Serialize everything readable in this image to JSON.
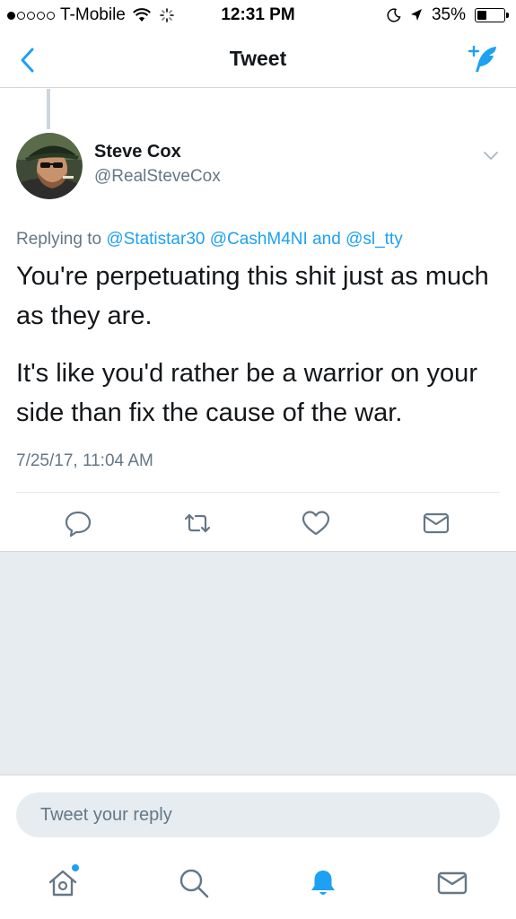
{
  "status_bar": {
    "carrier": "T-Mobile",
    "signal_bars_filled": 1,
    "signal_bars_total": 5,
    "time": "12:31 PM",
    "battery_percent": "35%",
    "battery_level": 0.35
  },
  "nav": {
    "title": "Tweet",
    "back_icon": "chevron-left-icon",
    "compose_icon": "compose-feather-icon"
  },
  "tweet": {
    "author_name": "Steve Cox",
    "author_handle": "@RealSteveCox",
    "replying_prefix": "Replying to",
    "mentions": [
      "@Statistar30",
      "@CashM4NI",
      "@sl_tty"
    ],
    "mention_joiner": "and",
    "paragraphs": [
      "You're perpetuating this shit just as much as they are.",
      "It's like you'd rather be a warrior on your side than fix the cause of the war."
    ],
    "timestamp": "7/25/17, 11:04 AM",
    "actions": [
      "reply-icon",
      "retweet-icon",
      "like-icon",
      "direct-message-icon"
    ]
  },
  "reply": {
    "placeholder": "Tweet your reply"
  },
  "tab_bar": {
    "tabs": [
      "home-icon",
      "search-icon",
      "notifications-icon",
      "messages-icon"
    ],
    "active": "notifications-icon"
  },
  "colors": {
    "accent": "#1da1f2",
    "text_primary": "#14171a",
    "text_secondary": "#657786",
    "background_gray": "#e6ecf0"
  }
}
